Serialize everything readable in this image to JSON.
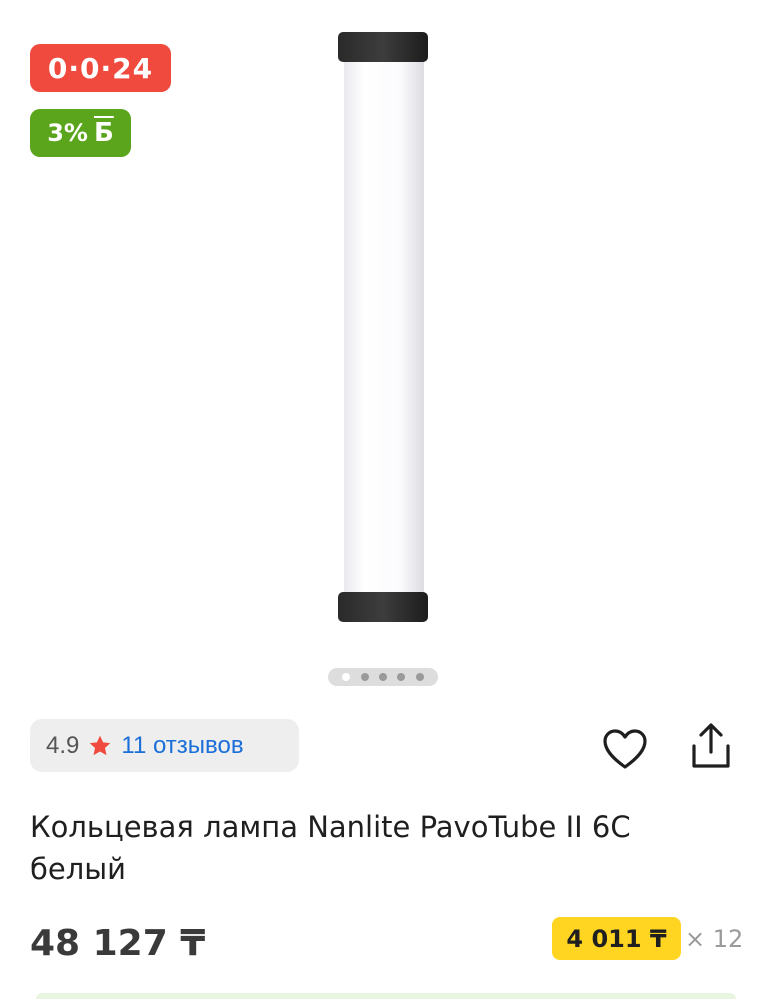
{
  "badges": {
    "installment": "0·0·24",
    "bonus_percent": "3%",
    "bonus_symbol": "Б"
  },
  "gallery": {
    "image_count": 5,
    "active_index": 0
  },
  "rating": {
    "value": "4.9",
    "reviews_label": "11 отзывов"
  },
  "product": {
    "title": "Кольцевая лампа Nanlite PavoTube II 6C белый",
    "price": "48 127 ₸",
    "monthly_payment": "4 011 ₸",
    "months": "× 12"
  },
  "colors": {
    "installment_badge": "#f0493e",
    "bonus_badge": "#5aa51c",
    "monthly_chip": "#ffd522",
    "link": "#1a6fd8",
    "star": "#f0493e"
  },
  "icons": [
    "star-icon",
    "heart-icon",
    "share-icon"
  ]
}
